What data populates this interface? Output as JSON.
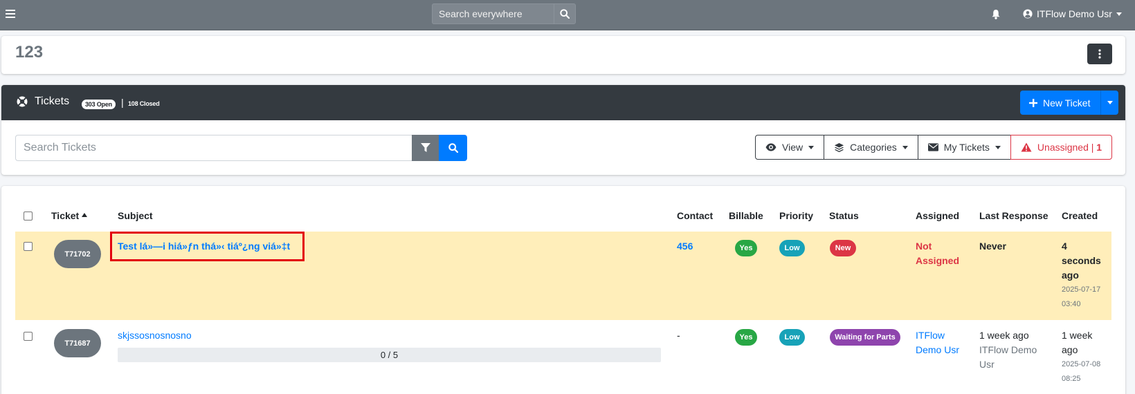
{
  "navbar": {
    "search_placeholder": "Search everywhere",
    "user_name": "ITFlow Demo Usr"
  },
  "client": {
    "title": "123"
  },
  "tickets": {
    "title": "Tickets",
    "open_badge": "303 Open",
    "separator": "|",
    "closed_label": "108 Closed",
    "new_ticket_label": "New Ticket",
    "search_placeholder": "Search Tickets",
    "filters": {
      "view": "View",
      "categories": "Categories",
      "my_tickets": "My Tickets",
      "unassigned": "Unassigned |",
      "unassigned_count": "1"
    }
  },
  "table": {
    "headers": {
      "ticket": "Ticket",
      "subject": "Subject",
      "contact": "Contact",
      "billable": "Billable",
      "priority": "Priority",
      "status": "Status",
      "assigned": "Assigned",
      "last_response": "Last Response",
      "created": "Created"
    },
    "rows": [
      {
        "number": "T71702",
        "subject": "Test lá»—i hiá»ƒn thá»‹ tiáº¿ng viá»‡t",
        "contact": "456",
        "billable": "Yes",
        "priority": "Low",
        "status": "New",
        "assigned_1": "Not",
        "assigned_2": "Assigned",
        "last_response": "Never",
        "created_1": "4",
        "created_2": "seconds",
        "created_3": "ago",
        "created_date": "2025-07-17",
        "created_time": "03:40"
      },
      {
        "number": "T71687",
        "subject": "skjssosnosnosno",
        "progress": "0 / 5",
        "contact": "-",
        "billable": "Yes",
        "priority": "Low",
        "status": "Waiting for Parts",
        "assigned_1": "ITFlow",
        "assigned_2": "Demo Usr",
        "last_response_1": "1 week ago",
        "last_response_2": "ITFlow Demo",
        "last_response_3": "Usr",
        "created_1": "1 week",
        "created_2": "ago",
        "created_date": "2025-07-08",
        "created_time": "08:25"
      }
    ]
  },
  "colors": {
    "primary": "#007bff",
    "success": "#28a745",
    "info": "#17a2b8",
    "danger": "#dc3545",
    "purple": "#8e44ad",
    "highlight_row": "#ffeeba",
    "navbar": "#6c757d",
    "dark": "#343a40"
  },
  "icons": [
    "hamburger-icon",
    "search-icon",
    "bell-icon",
    "user-circle-icon",
    "ellipsis-vertical-icon",
    "life-ring-icon",
    "plus-icon",
    "filter-icon",
    "eye-icon",
    "layer-group-icon",
    "envelope-icon",
    "warning-triangle-icon",
    "sort-up-icon"
  ]
}
